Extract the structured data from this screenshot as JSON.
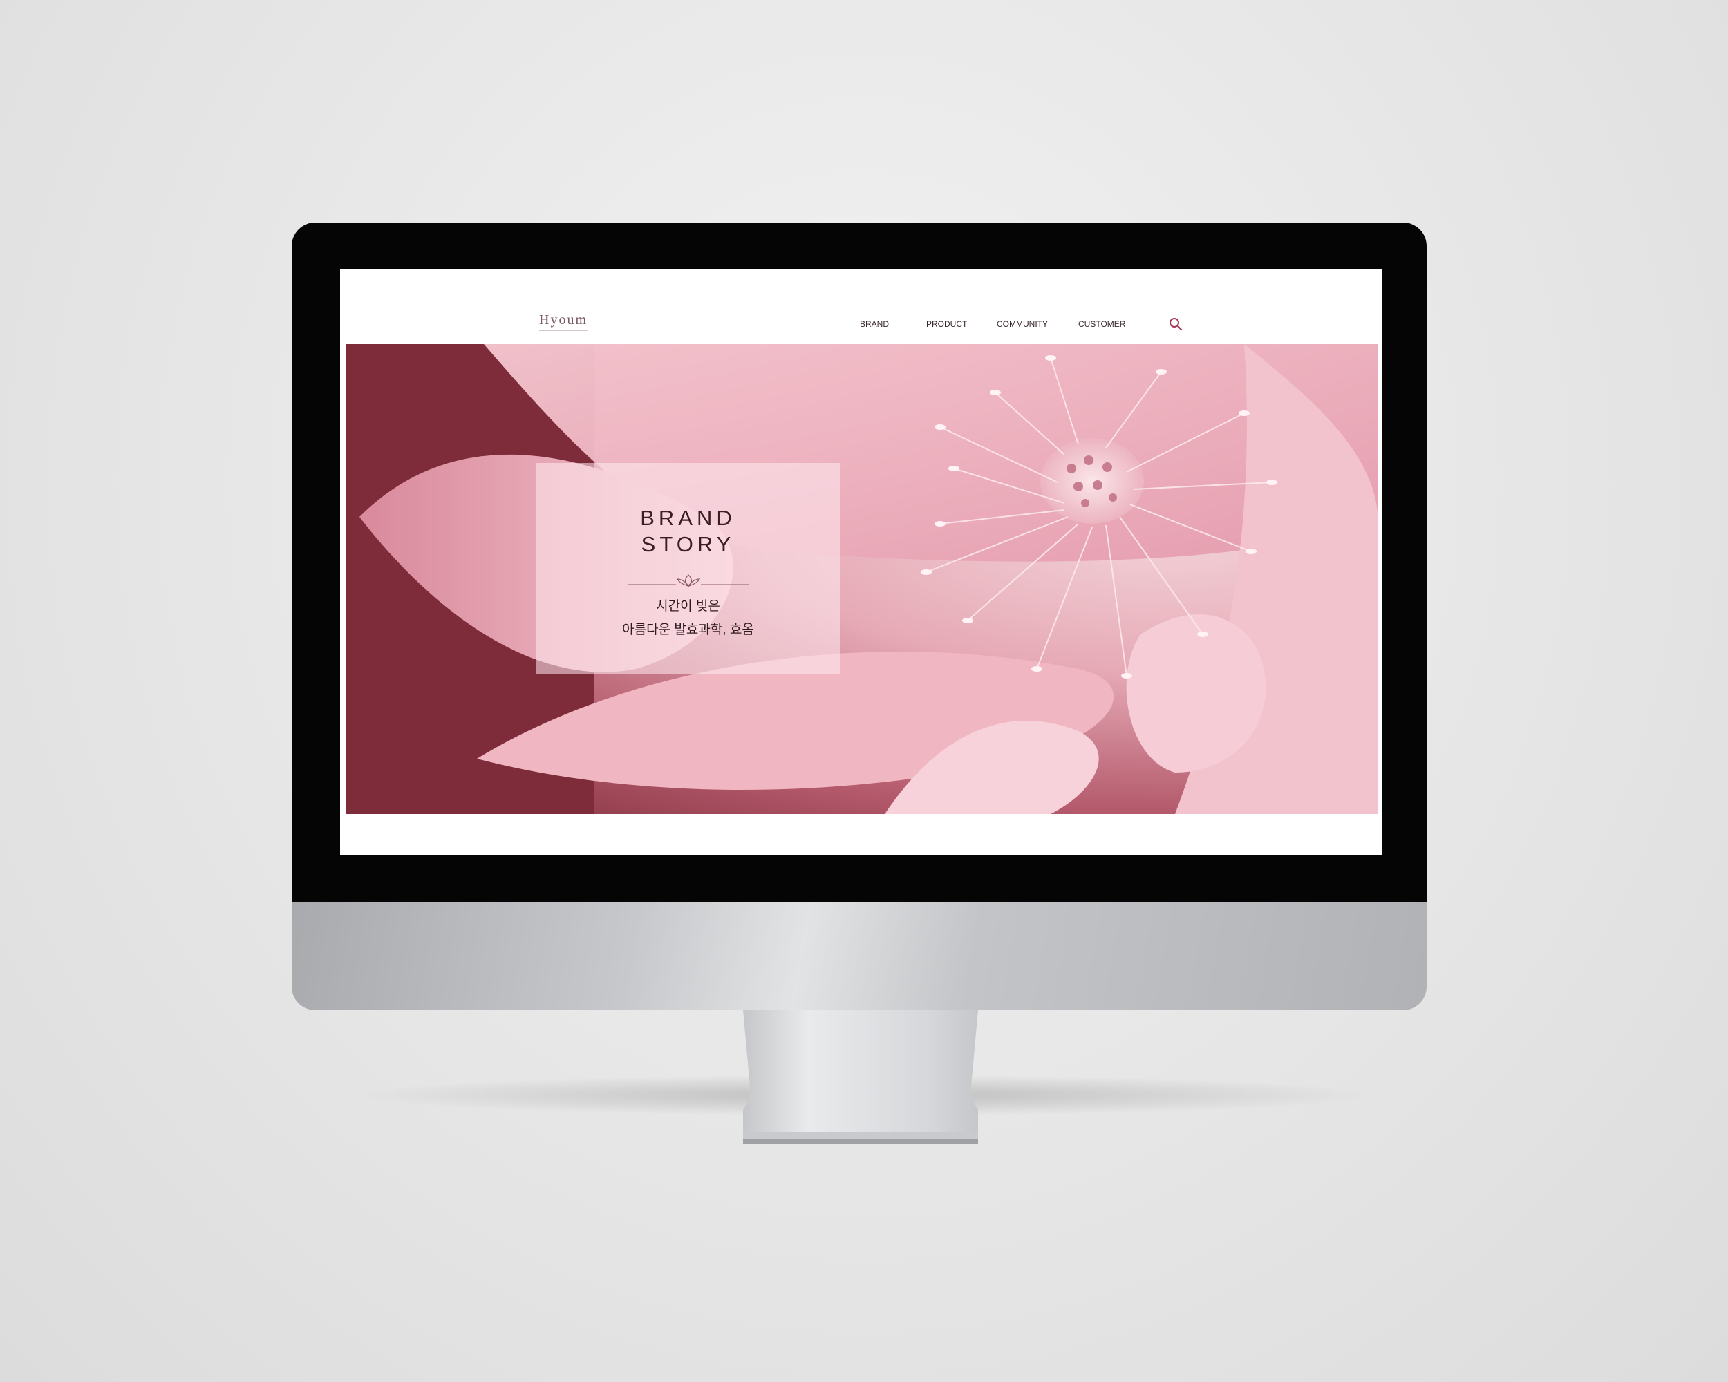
{
  "site": {
    "logo": "Hyoum",
    "nav": {
      "items": [
        {
          "label": "BRAND"
        },
        {
          "label": "PRODUCT"
        },
        {
          "label": "COMMUNITY"
        },
        {
          "label": "CUSTOMER"
        }
      ],
      "search_icon": "search-icon"
    },
    "hero": {
      "title_line1": "BRAND",
      "title_line2": "STORY",
      "ornament_icon": "lotus-icon",
      "subtitle_line1": "시간이 빚은",
      "subtitle_line2": "아름다운 발효과학, 효옴"
    }
  },
  "colors": {
    "accent": "#a33a52",
    "hero_dark": "#7a2a37",
    "hero_light": "#f3d2d8"
  }
}
